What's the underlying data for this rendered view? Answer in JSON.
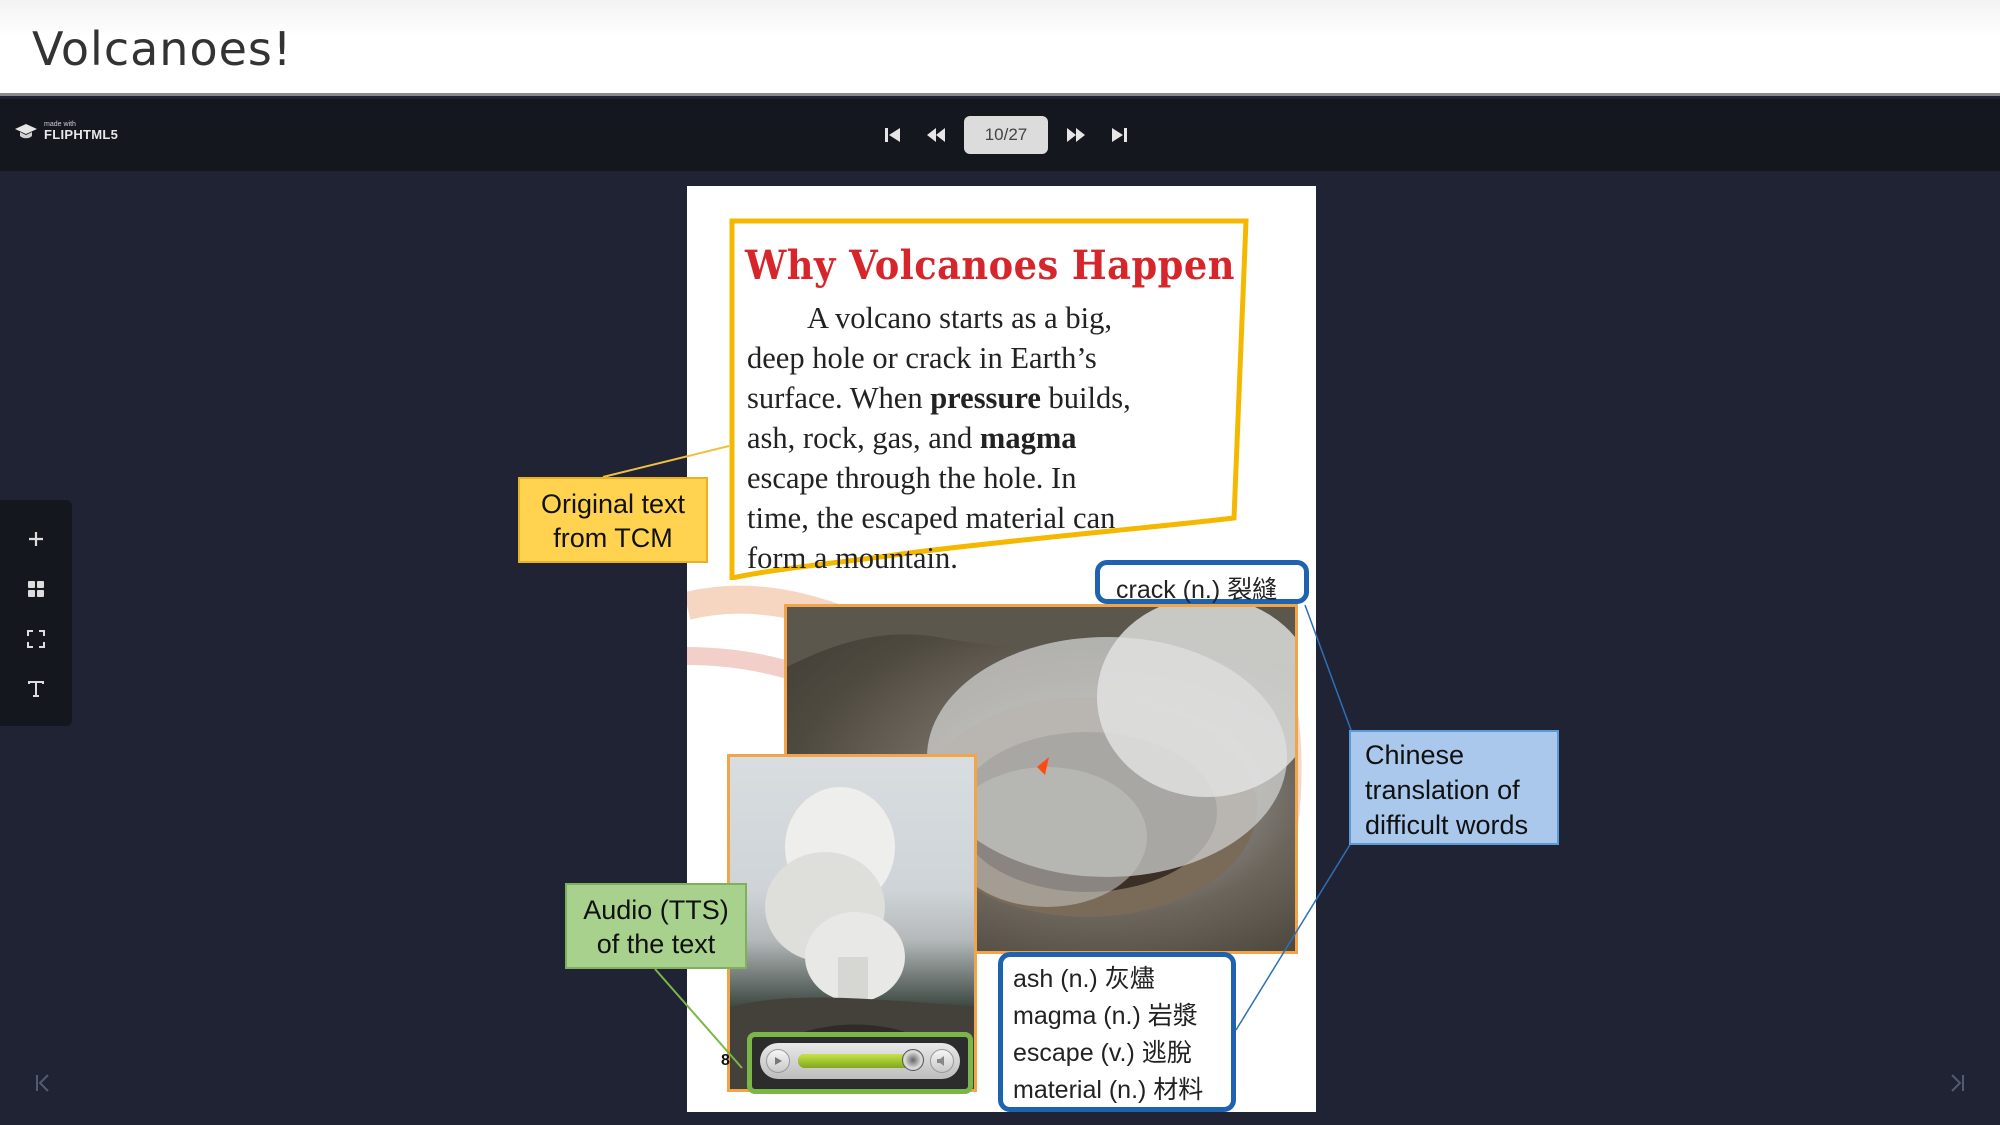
{
  "window": {
    "title": "Volcanoes!"
  },
  "toolbar": {
    "logo_small": "made with",
    "logo_big": "FLIPHTML5",
    "page_indicator": "10/27"
  },
  "icons": {
    "first": "first-page-icon",
    "prev": "rewind-icon",
    "next": "fast-forward-icon",
    "last": "last-page-icon",
    "zoom": "plus-icon",
    "thumbnails": "grid-icon",
    "fullscreen": "fullscreen-icon",
    "text": "text-icon"
  },
  "book_page": {
    "heading": "Why Volcanoes Happen",
    "lines": [
      "A volcano starts as a big,",
      "deep hole or crack in Earth’s",
      "surface.  When ",
      "pressure",
      " builds,",
      "ash, rock, gas, and ",
      "magma",
      "escape through the hole.  In",
      "time, the escaped material can",
      "form a mountain."
    ],
    "page_number": "8"
  },
  "annotations": {
    "original_text": [
      "Original text",
      "from TCM"
    ],
    "audio": [
      "Audio (TTS)",
      "of the text"
    ],
    "translation": [
      "Chinese",
      "translation of",
      "difficult words"
    ]
  },
  "vocab": {
    "top": "crack (n.) 裂縫",
    "list": [
      "ash (n.) 灰燼",
      "magma (n.) 岩漿",
      "escape (v.) 逃脫",
      "material (n.) 材料"
    ]
  },
  "audio_player": {
    "progress": 0.93
  },
  "colors": {
    "background": "#1f2333",
    "toolbar": "#15171f",
    "heading_red": "#d7262b",
    "yellow_note": "#ffd24f",
    "green_note": "#a9d18e",
    "blue_note": "#a9c8ec",
    "vocab_border": "#1f62b0"
  }
}
